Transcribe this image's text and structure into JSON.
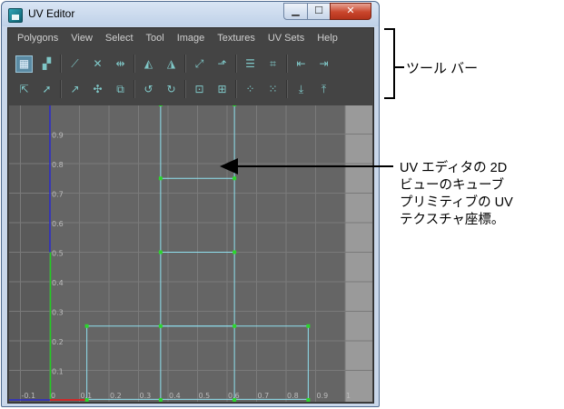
{
  "window": {
    "title": "UV Editor",
    "buttons": {
      "minimize": "▁",
      "maximize": "☐",
      "close": "✕"
    }
  },
  "menu": [
    "Polygons",
    "View",
    "Select",
    "Tool",
    "Image",
    "Textures",
    "UV Sets",
    "Help"
  ],
  "toolbar": {
    "row1": [
      {
        "name": "uv-layout-icon",
        "glyph": "▦",
        "active": true
      },
      {
        "name": "uv-snapshot-icon",
        "glyph": "▞",
        "active": false
      },
      {
        "sep": true
      },
      {
        "name": "cut-uv-icon",
        "glyph": "⟋",
        "active": false
      },
      {
        "name": "delete-uv-icon",
        "glyph": "✕",
        "active": false
      },
      {
        "name": "sew-uv-icon",
        "glyph": "⇹",
        "active": false
      },
      {
        "sep": true
      },
      {
        "name": "flip-u-icon",
        "glyph": "◭",
        "active": false
      },
      {
        "name": "flip-v-icon",
        "glyph": "◮",
        "active": false
      },
      {
        "sep": true
      },
      {
        "name": "move-sew-icon",
        "glyph": "⤢",
        "active": false
      },
      {
        "name": "unfold-icon",
        "glyph": "⬏",
        "active": false
      },
      {
        "sep": true
      },
      {
        "name": "stack-icon",
        "glyph": "☰",
        "active": false
      },
      {
        "name": "grid-uv-icon",
        "glyph": "⌗",
        "active": false
      },
      {
        "sep": true
      },
      {
        "name": "align-min-u-icon",
        "glyph": "⇤",
        "active": false
      },
      {
        "name": "align-max-u-icon",
        "glyph": "⇥",
        "active": false
      }
    ],
    "row2": [
      {
        "name": "select-uv-icon",
        "glyph": "⇱",
        "active": false
      },
      {
        "name": "select-tool-icon",
        "glyph": "➚",
        "active": false
      },
      {
        "sep": true
      },
      {
        "name": "smooth-uv-icon",
        "glyph": "↗",
        "active": false
      },
      {
        "name": "lattice-icon",
        "glyph": "✣",
        "active": false
      },
      {
        "name": "cube-map-icon",
        "glyph": "⧉",
        "active": false
      },
      {
        "sep": true
      },
      {
        "name": "rotate-ccw-icon",
        "glyph": "↺",
        "active": false
      },
      {
        "name": "rotate-cw-icon",
        "glyph": "↻",
        "active": false
      },
      {
        "sep": true
      },
      {
        "name": "shell-select-icon",
        "glyph": "⊡",
        "active": false
      },
      {
        "name": "border-select-icon",
        "glyph": "⊞",
        "active": false
      },
      {
        "sep": true
      },
      {
        "name": "distribute-icon",
        "glyph": "⁘",
        "active": false
      },
      {
        "name": "normalize-icon",
        "glyph": "⁙",
        "active": false
      },
      {
        "sep": true
      },
      {
        "name": "align-min-v-icon",
        "glyph": "⤓",
        "active": false
      },
      {
        "name": "align-max-v-icon",
        "glyph": "⤒",
        "active": false
      }
    ]
  },
  "viewport": {
    "u_labels": [
      "-0.1",
      "0",
      "0.1",
      "0.2",
      "0.3",
      "0.4",
      "0.5",
      "0.6",
      "0.7",
      "0.8",
      "0.9",
      "1"
    ],
    "v_labels": [
      "0.1",
      "0.2",
      "0.3",
      "0.4",
      "0.5",
      "0.6",
      "0.7",
      "0.8",
      "0.9"
    ],
    "colors": {
      "outside": "#9a9a9a",
      "uv_space": "#656565",
      "grid": "#7a7a7a",
      "uv_edges": "#8fe0ef",
      "uv_points": "#2cd62c",
      "u_axis": "#cc2a2a",
      "v_axis": "#2a2acc",
      "axis_green": "#23cc23"
    },
    "uv_points": [
      [
        0.375,
        0.0
      ],
      [
        0.625,
        0.0
      ],
      [
        0.125,
        0.0
      ],
      [
        0.875,
        0.0
      ],
      [
        0.375,
        0.25
      ],
      [
        0.625,
        0.25
      ],
      [
        0.125,
        0.25
      ],
      [
        0.875,
        0.25
      ],
      [
        0.375,
        0.5
      ],
      [
        0.625,
        0.5
      ],
      [
        0.375,
        0.75
      ],
      [
        0.625,
        0.75
      ],
      [
        0.375,
        1.0
      ],
      [
        0.625,
        1.0
      ]
    ]
  },
  "annotations": {
    "toolbar_label": "ツール バー",
    "callout_lines": [
      "UV エディタの 2D",
      "ビューのキューブ",
      "プリミティブの UV",
      "テクスチャ座標。"
    ]
  }
}
